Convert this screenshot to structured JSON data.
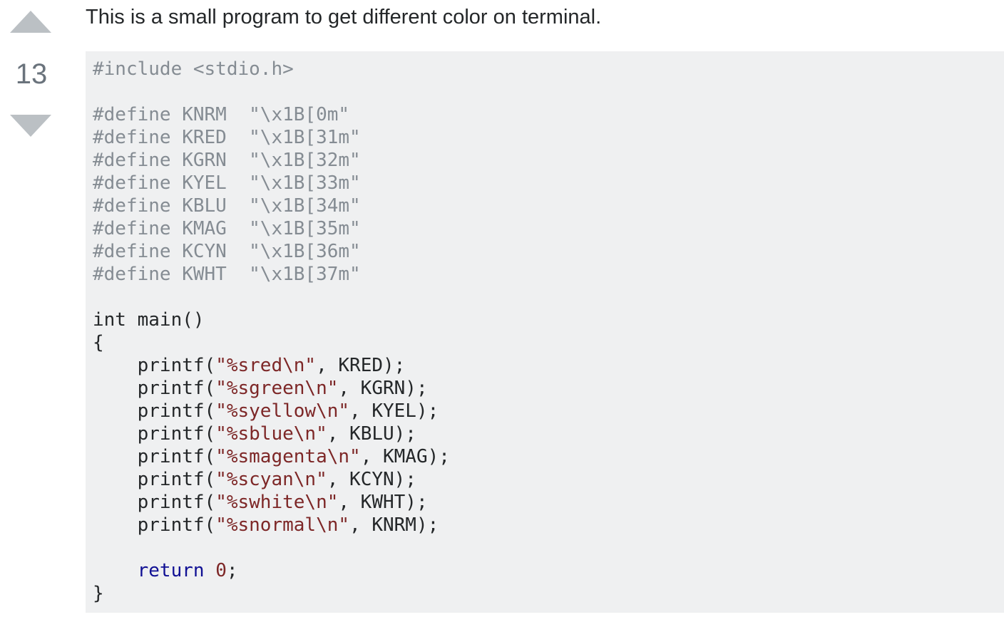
{
  "vote": {
    "count": "13",
    "up_label": "up vote",
    "down_label": "down vote"
  },
  "post": {
    "text": "This is a small program to get different color on terminal."
  },
  "code": {
    "lines": [
      [
        {
          "t": "#include <stdio.h>",
          "c": "pp"
        }
      ],
      [],
      [
        {
          "t": "#define KNRM  \"\\x1B[0m\"",
          "c": "pp"
        }
      ],
      [
        {
          "t": "#define KRED  \"\\x1B[31m\"",
          "c": "pp"
        }
      ],
      [
        {
          "t": "#define KGRN  \"\\x1B[32m\"",
          "c": "pp"
        }
      ],
      [
        {
          "t": "#define KYEL  \"\\x1B[33m\"",
          "c": "pp"
        }
      ],
      [
        {
          "t": "#define KBLU  \"\\x1B[34m\"",
          "c": "pp"
        }
      ],
      [
        {
          "t": "#define KMAG  \"\\x1B[35m\"",
          "c": "pp"
        }
      ],
      [
        {
          "t": "#define KCYN  \"\\x1B[36m\"",
          "c": "pp"
        }
      ],
      [
        {
          "t": "#define KWHT  \"\\x1B[37m\"",
          "c": "pp"
        }
      ],
      [],
      [
        {
          "t": "int main()",
          "c": "pln"
        }
      ],
      [
        {
          "t": "{",
          "c": "pln"
        }
      ],
      [
        {
          "t": "    printf(",
          "c": "pln"
        },
        {
          "t": "\"%sred\\n\"",
          "c": "str"
        },
        {
          "t": ", KRED);",
          "c": "pln"
        }
      ],
      [
        {
          "t": "    printf(",
          "c": "pln"
        },
        {
          "t": "\"%sgreen\\n\"",
          "c": "str"
        },
        {
          "t": ", KGRN);",
          "c": "pln"
        }
      ],
      [
        {
          "t": "    printf(",
          "c": "pln"
        },
        {
          "t": "\"%syellow\\n\"",
          "c": "str"
        },
        {
          "t": ", KYEL);",
          "c": "pln"
        }
      ],
      [
        {
          "t": "    printf(",
          "c": "pln"
        },
        {
          "t": "\"%sblue\\n\"",
          "c": "str"
        },
        {
          "t": ", KBLU);",
          "c": "pln"
        }
      ],
      [
        {
          "t": "    printf(",
          "c": "pln"
        },
        {
          "t": "\"%smagenta\\n\"",
          "c": "str"
        },
        {
          "t": ", KMAG);",
          "c": "pln"
        }
      ],
      [
        {
          "t": "    printf(",
          "c": "pln"
        },
        {
          "t": "\"%scyan\\n\"",
          "c": "str"
        },
        {
          "t": ", KCYN);",
          "c": "pln"
        }
      ],
      [
        {
          "t": "    printf(",
          "c": "pln"
        },
        {
          "t": "\"%swhite\\n\"",
          "c": "str"
        },
        {
          "t": ", KWHT);",
          "c": "pln"
        }
      ],
      [
        {
          "t": "    printf(",
          "c": "pln"
        },
        {
          "t": "\"%snormal\\n\"",
          "c": "str"
        },
        {
          "t": ", KNRM);",
          "c": "pln"
        }
      ],
      [],
      [
        {
          "t": "    ",
          "c": "pln"
        },
        {
          "t": "return",
          "c": "kw"
        },
        {
          "t": " ",
          "c": "pln"
        },
        {
          "t": "0",
          "c": "num"
        },
        {
          "t": ";",
          "c": "pln"
        }
      ],
      [
        {
          "t": "}",
          "c": "pln"
        }
      ]
    ]
  },
  "colors": {
    "vote_arrow": "#bbc0c4",
    "vote_count": "#6a737c",
    "code_background": "#eff0f1",
    "preprocessor": "#858c93",
    "string": "#7d2727",
    "keyword": "#101094",
    "plain": "#242729"
  }
}
